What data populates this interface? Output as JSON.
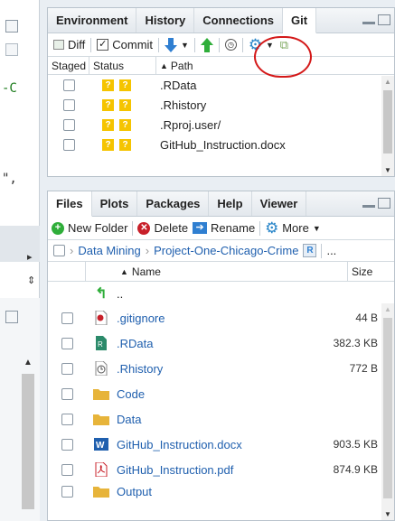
{
  "left": {
    "code1": "-C",
    "code2": "\",",
    "btn_arrow": "▸",
    "btn_updown": "⇕"
  },
  "git_pane": {
    "tabs": [
      "Environment",
      "History",
      "Connections",
      "Git"
    ],
    "toolbar": {
      "diff": "Diff",
      "commit": "Commit",
      "pull_icon": "pull-arrow-icon",
      "push_icon": "push-arrow-icon"
    },
    "columns": {
      "staged": "Staged",
      "status": "Status",
      "path": "Path"
    },
    "rows": [
      {
        "path": ".RData",
        "status": "?"
      },
      {
        "path": ".Rhistory",
        "status": "?"
      },
      {
        "path": ".Rproj.user/",
        "status": "?"
      },
      {
        "path": "GitHub_Instruction.docx",
        "status": "?"
      }
    ]
  },
  "files_pane": {
    "tabs": [
      "Files",
      "Plots",
      "Packages",
      "Help",
      "Viewer"
    ],
    "toolbar": {
      "new_folder": "New Folder",
      "delete": "Delete",
      "rename": "Rename",
      "more": "More"
    },
    "breadcrumb": [
      "Data Mining",
      "Project-One-Chicago-Crime"
    ],
    "breadcrumb_more": "...",
    "columns": {
      "name": "Name",
      "size": "Size"
    },
    "parent": "..",
    "files": [
      {
        "name": ".gitignore",
        "icon": "text-file-icon",
        "size": "44 B"
      },
      {
        "name": ".RData",
        "icon": "rdata-icon",
        "size": "382.3 KB"
      },
      {
        "name": ".Rhistory",
        "icon": "history-icon",
        "size": "772 B"
      },
      {
        "name": "Code",
        "icon": "folder-icon",
        "size": ""
      },
      {
        "name": "Data",
        "icon": "folder-icon",
        "size": ""
      },
      {
        "name": "GitHub_Instruction.docx",
        "icon": "word-icon",
        "size": "903.5 KB"
      },
      {
        "name": "GitHub_Instruction.pdf",
        "icon": "pdf-icon",
        "size": "874.9 KB"
      },
      {
        "name": "Output",
        "icon": "folder-icon",
        "size": ""
      }
    ]
  }
}
